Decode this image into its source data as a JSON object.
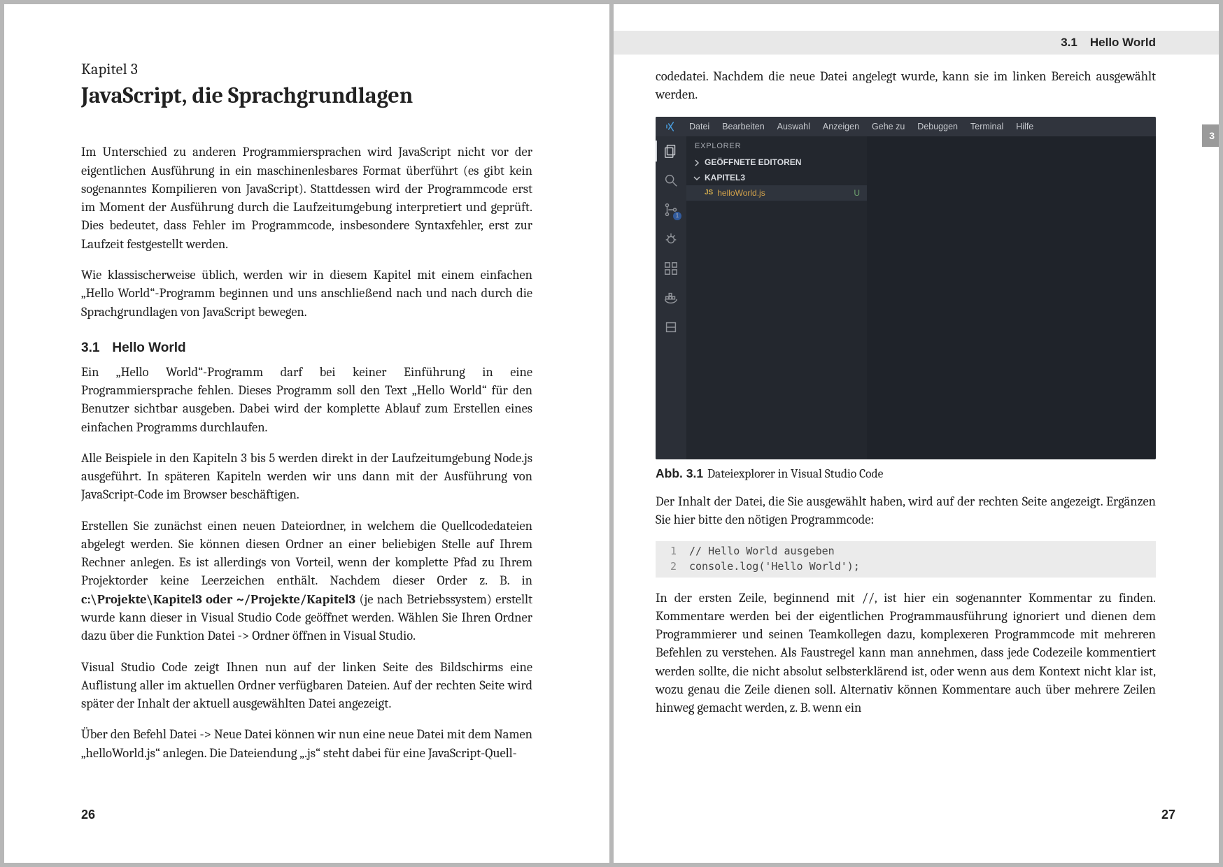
{
  "left": {
    "kapitel": "Kapitel 3",
    "title": "JavaScript, die Sprachgrundlagen",
    "p1": "Im Unterschied zu anderen Programmiersprachen wird JavaScript nicht vor der eigentlichen Ausführung in ein maschinenlesbares Format überführt (es gibt kein sogenanntes Kompilieren von JavaScript). Stattdessen wird der Programmcode erst im Moment der Ausführung durch die Laufzeitumgebung interpretiert und geprüft. Dies bedeutet, dass Fehler im Programmcode, insbesondere Syntaxfehler, erst zur Laufzeit festgestellt werden.",
    "p2": "Wie klassischerweise üblich, werden wir in diesem Kapitel mit einem einfachen „Hello World“-Programm beginnen und uns anschließend nach und nach durch die Sprachgrundlagen von JavaScript bewegen.",
    "sec_num": "3.1",
    "sec_title": "Hello World",
    "p3": "Ein „Hello World“-Programm darf bei keiner Einführung in eine Programmiersprache fehlen. Dieses Programm soll den Text „Hello World“ für den Benutzer sichtbar ausgeben. Dabei wird der komplette Ablauf zum Erstellen eines einfachen Programms durchlaufen.",
    "p4": "Alle Beispiele in den Kapiteln 3 bis 5 werden direkt in der Laufzeitumgebung Node.js ausgeführt. In späteren Kapiteln werden wir uns dann mit der Ausführung von JavaScript-Code im Browser beschäftigen.",
    "p5a": "Erstellen Sie zunächst einen neuen Dateiordner, in welchem die Quellcodedateien abgelegt werden. Sie können diesen Ordner an einer beliebigen Stelle auf Ihrem Rechner anlegen. Es ist allerdings von Vorteil, wenn der komplette Pfad zu Ihrem Projektorder keine Leerzeichen enthält. Nachdem dieser Order z. B. in ",
    "p5path": "c:\\Projekte\\Kapitel3 oder ~/Projekte/Kapitel3",
    "p5b": " (je nach Betriebssystem) erstellt wurde kann dieser in Visual Studio Code geöffnet werden. Wählen Sie Ihren Ordner dazu über die Funktion Datei -> Ordner öffnen in Visual Studio.",
    "p6": "Visual Studio Code zeigt Ihnen nun auf der linken Seite des Bildschirms eine Auflistung aller im aktuellen Ordner verfügbaren Dateien. Auf der rechten Seite wird später der Inhalt der aktuell ausgewählten Datei angezeigt.",
    "p7": "Über den Befehl Datei -> Neue Datei können wir nun eine neue Datei mit dem Namen „helloWorld.js“ anlegen. Die Dateiendung „.js“ steht dabei für eine JavaScript-Quell-",
    "page_num": "26"
  },
  "right": {
    "runhead_num": "3.1",
    "runhead_title": "Hello World",
    "thumb": "3",
    "p_top": "codedatei. Nachdem die neue Datei angelegt wurde, kann sie im linken Bereich ausgewählt werden.",
    "vscode": {
      "menu": [
        "Datei",
        "Bearbeiten",
        "Auswahl",
        "Anzeigen",
        "Gehe zu",
        "Debuggen",
        "Terminal",
        "Hilfe"
      ],
      "explorer_title": "EXPLORER",
      "open_editors": "GEÖFFNETE EDITOREN",
      "project": "KAPITEL3",
      "file": "helloWorld.js",
      "file_prefix": "JS",
      "file_state": "U",
      "scm_badge": "1"
    },
    "fig_label": "Abb. 3.1",
    "fig_caption": "Dateiexplorer in Visual Studio Code",
    "p_after_fig": "Der Inhalt der Datei, die Sie ausgewählt haben, wird auf der rechten Seite angezeigt. Ergänzen Sie hier bitte den nötigen Programmcode:",
    "code": {
      "lines": [
        {
          "n": "1",
          "t": "// Hello World ausgeben"
        },
        {
          "n": "2",
          "t": "console.log('Hello World');"
        }
      ]
    },
    "p_bottom": "In der ersten Zeile, beginnend mit //, ist hier ein sogenannter Kommentar zu finden. Kommentare werden bei der eigentlichen Programmausführung ignoriert und dienen dem Programmierer und seinen Teamkollegen dazu, komplexeren Programmcode mit mehreren Befehlen zu verstehen. Als Faustregel kann man annehmen, dass jede Codezeile kommentiert werden sollte, die nicht absolut selbsterklärend ist, oder wenn aus dem Kontext nicht klar ist, wozu genau die Zeile dienen soll. Alternativ können Kommentare auch über mehrere Zeilen hinweg gemacht werden, z. B. wenn ein",
    "page_num": "27"
  }
}
